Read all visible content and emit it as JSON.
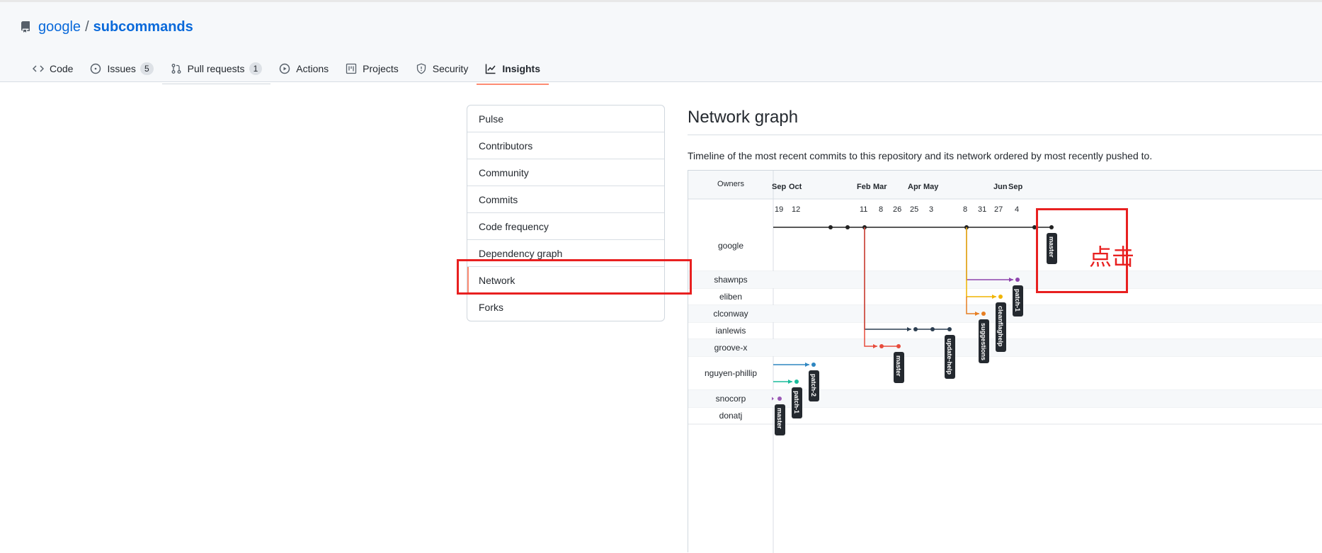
{
  "repo": {
    "owner": "google",
    "separator": "/",
    "name": "subcommands"
  },
  "tabs": [
    {
      "label": "Code",
      "icon": "code-icon"
    },
    {
      "label": "Issues",
      "count": "5",
      "icon": "issue-icon"
    },
    {
      "label": "Pull requests",
      "count": "1",
      "icon": "pull-request-icon"
    },
    {
      "label": "Actions",
      "icon": "play-icon"
    },
    {
      "label": "Projects",
      "icon": "project-icon"
    },
    {
      "label": "Security",
      "icon": "shield-icon"
    },
    {
      "label": "Insights",
      "icon": "graph-icon",
      "selected": true
    }
  ],
  "sidebar": {
    "items": [
      {
        "label": "Pulse"
      },
      {
        "label": "Contributors"
      },
      {
        "label": "Community"
      },
      {
        "label": "Commits"
      },
      {
        "label": "Code frequency"
      },
      {
        "label": "Dependency graph"
      },
      {
        "label": "Network",
        "selected": true
      },
      {
        "label": "Forks"
      }
    ]
  },
  "main": {
    "title": "Network graph",
    "description": "Timeline of the most recent commits to this repository and its network ordered by most recently pushed to."
  },
  "graph": {
    "owners_header": "Owners",
    "months": [
      "Sep",
      "Oct",
      "Feb",
      "Mar",
      "Apr",
      "May",
      "Jun",
      "Sep"
    ],
    "days": [
      "19",
      "12",
      "11",
      "8",
      "26",
      "25",
      "3",
      "8",
      "31",
      "27",
      "4"
    ],
    "owners": [
      "google",
      "shawnps",
      "eliben",
      "clconway",
      "ianlewis",
      "groove-x",
      "nguyen-phillip",
      "snocorp",
      "donatj"
    ],
    "branch_labels": [
      "master",
      "patch-1",
      "cleanflaghelp",
      "suggestions",
      "update-help",
      "master",
      "patch-2",
      "patch-1",
      "master"
    ],
    "colors": {
      "google": "#222222",
      "shawnps": "#8e44ad",
      "eliben": "#f0b400",
      "clconway": "#e67e22",
      "ianlewis": "#2c3e50",
      "groove-x": "#e74c3c",
      "nguyen-phillip-a": "#2e86c1",
      "nguyen-phillip-b": "#1abc9c",
      "snocorp": "#9b59b6"
    }
  },
  "annotation": {
    "text": "点击",
    "color": "#e82020"
  }
}
